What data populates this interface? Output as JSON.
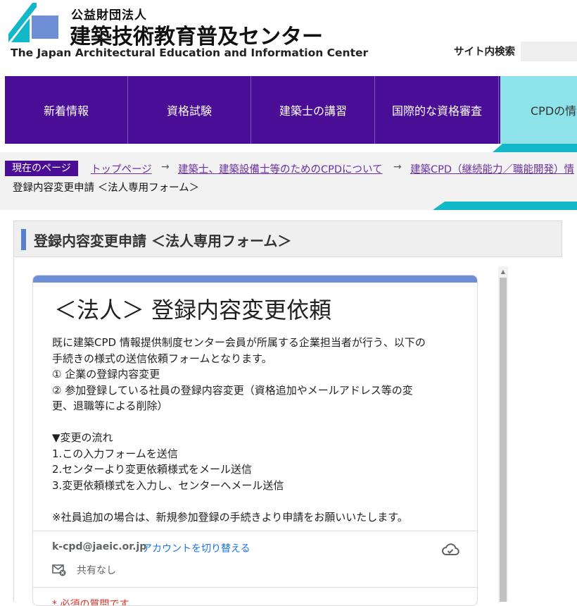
{
  "header": {
    "org_type": "公益財団法人",
    "org_name": "建築技術教育普及センター",
    "org_name_en": "The Japan Architectural Education and Information Center",
    "search_label": "サイト内検索",
    "search_value": ""
  },
  "nav": {
    "items": [
      {
        "label": "新着情報"
      },
      {
        "label": "資格試験"
      },
      {
        "label": "建築士の講習"
      },
      {
        "label": "国際的な資格審査"
      },
      {
        "label": "CPDの情"
      }
    ],
    "active_index": 4
  },
  "breadcrumb": {
    "current_label": "現在のページ",
    "links": [
      "トップページ",
      "建築士、建築設備士等のためのCPDについて",
      "建築CPD（継続能力／職能開発）情"
    ],
    "current_page": "登録内容変更申請 ＜法人専用フォーム＞"
  },
  "page": {
    "title": "登録内容変更申請 ＜法人専用フォーム＞"
  },
  "form": {
    "title": "＜法人＞ 登録内容変更依頼",
    "description_lines": [
      "既に建築CPD 情報提供制度センター会員が所属する企業担当者が行う、以下の",
      "手続きの様式の送信依頼フォームとなります。",
      "① 企業の登録内容変更",
      "② 参加登録している社員の登録内容変更（資格追加やメールアドレス等の変",
      "更、退職等による削除）",
      "",
      "▼変更の流れ",
      "1.この入力フォームを送信",
      "2.センターより変更依頼様式をメール送信",
      "3.変更依頼様式を入力し、センターへメール送信",
      "",
      "※社員追加の場合は、新規参加登録の手続きより申請をお願いいたします。"
    ],
    "account_email": "k-cpd@jaeic.or.jp",
    "switch_account": "アカウントを切り替える",
    "not_shared": "共有なし",
    "required_note": "* 必須の質問です"
  },
  "icons": {
    "logo": "jaeic-logo",
    "cloud": "cloud-check-icon",
    "mail": "mail-not-shared-icon",
    "arrow": "arrow-right-icon"
  },
  "colors": {
    "nav_bg": "#4a0e96",
    "nav_active_bg": "#8ee2ea",
    "accent_teal": "#12b8c8",
    "form_accent": "#6e8fd6",
    "link": "#1a73e8",
    "breadcrumb_link": "#6b2fa3"
  }
}
